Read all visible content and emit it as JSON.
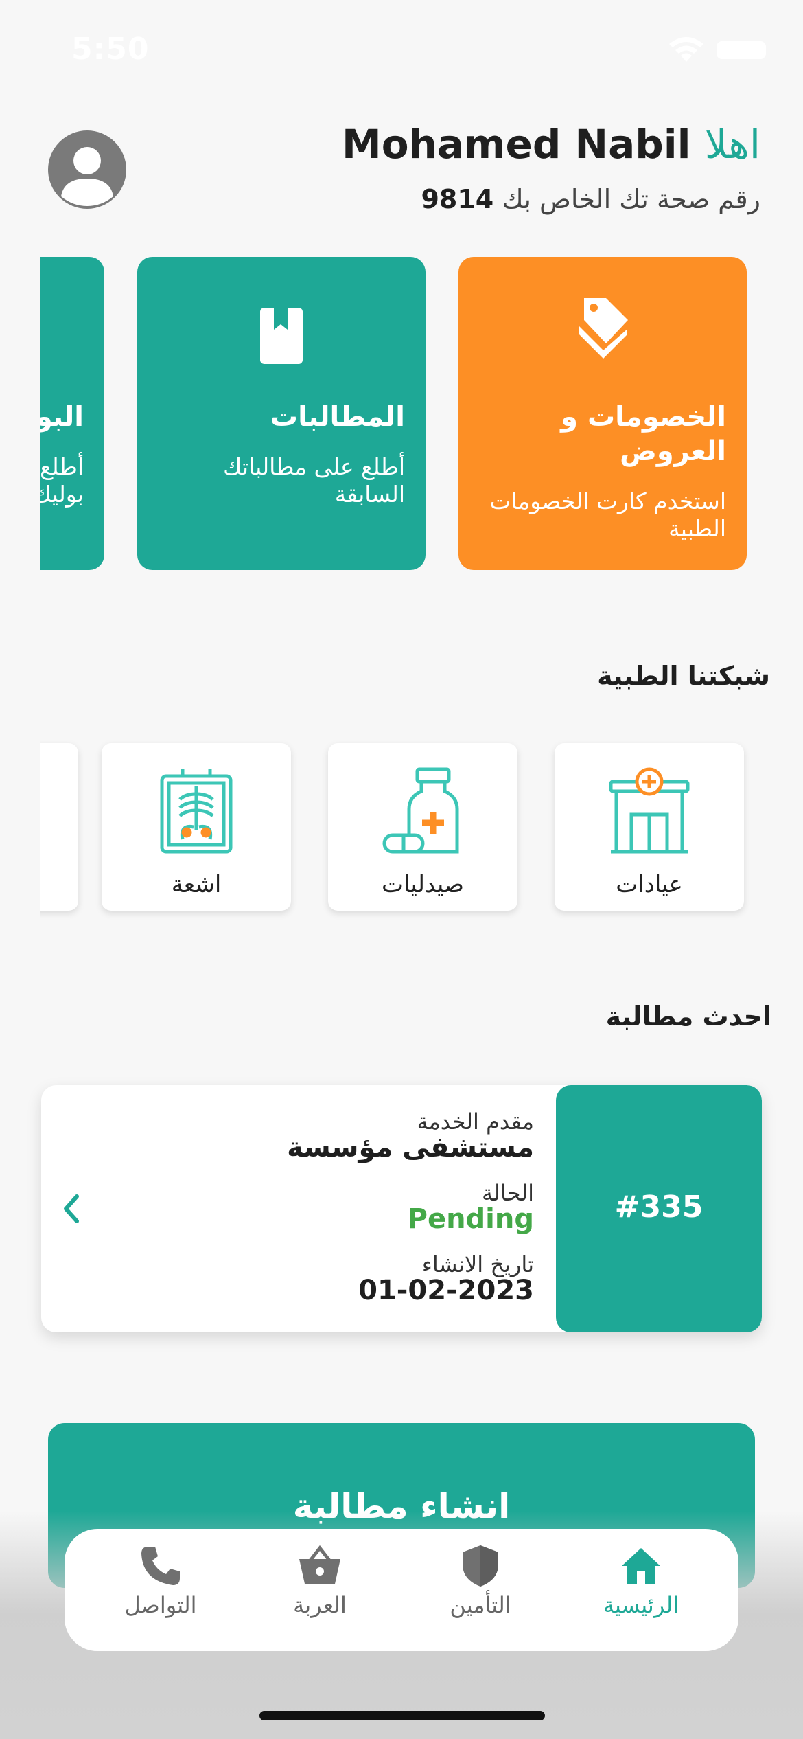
{
  "status_bar": {
    "time": "5:50"
  },
  "header": {
    "greeting_prefix": "اهلا",
    "user_name": "Mohamed Nabil",
    "health_label": "رقم صحة تك الخاص بك",
    "health_number": "9814"
  },
  "feature_cards": [
    {
      "title": "الخصومات و العروض",
      "description": "استخدم كارت الخصومات الطبية",
      "icon": "tags-icon",
      "color": "#fd8f25"
    },
    {
      "title": "المطالبات",
      "description": "أطلع على مطالباتك السابقة",
      "icon": "bookmark-book-icon",
      "color": "#1ea896"
    },
    {
      "title": "البو",
      "description": "أطلع بوليك",
      "icon": "",
      "color": "#1ea896"
    }
  ],
  "network": {
    "title": "شبكتنا الطبية",
    "items": [
      {
        "label": "عيادات",
        "icon": "clinic-icon"
      },
      {
        "label": "صيدليات",
        "icon": "pharmacy-icon"
      },
      {
        "label": "اشعة",
        "icon": "xray-icon"
      }
    ]
  },
  "latest_claim": {
    "title": "احدث مطالبة",
    "id": "#335",
    "provider_label": "مقدم الخدمة",
    "provider_value": "مستشفى مؤسسة",
    "status_label": "الحالة",
    "status_value": "Pending",
    "date_label": "تاريخ الانشاء",
    "date_value": "01-02-2023"
  },
  "create_claim": {
    "label": "انشاء مطالبة"
  },
  "bottom_nav": [
    {
      "label": "الرئيسية",
      "icon": "home-icon",
      "active": true
    },
    {
      "label": "التأمين",
      "icon": "shield-icon",
      "active": false
    },
    {
      "label": "العربة",
      "icon": "basket-icon",
      "active": false
    },
    {
      "label": "التواصل",
      "icon": "phone-icon",
      "active": false
    }
  ],
  "colors": {
    "teal": "#1ea896",
    "orange": "#fd8f25",
    "pending": "#44a848"
  }
}
